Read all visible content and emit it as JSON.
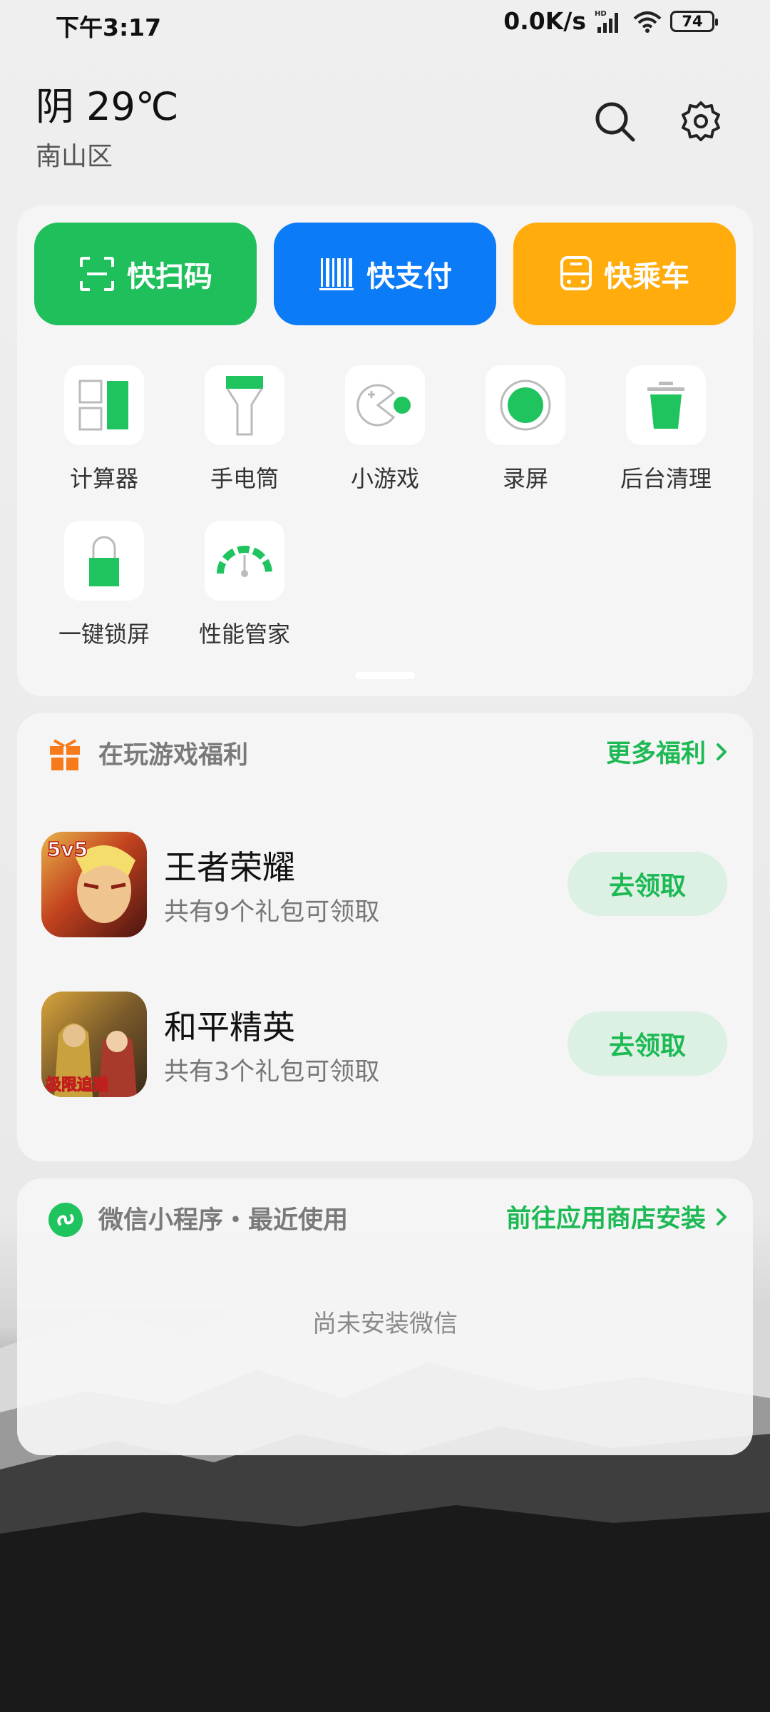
{
  "status_bar": {
    "time": "下午3:17",
    "net_speed": "0.0K/s",
    "network_badge": "HD",
    "battery": "74"
  },
  "header": {
    "weather": "阴 29℃",
    "district": "南山区",
    "search_icon": "search-icon",
    "settings_icon": "gear-icon"
  },
  "quick_actions": [
    {
      "label": "快扫码",
      "color": "#1fbf5c",
      "icon": "scan-icon"
    },
    {
      "label": "快支付",
      "color": "#0b7bf7",
      "icon": "barcode-icon"
    },
    {
      "label": "快乘车",
      "color": "#ffac0c",
      "icon": "bus-icon"
    }
  ],
  "tools": [
    {
      "label": "计算器",
      "icon": "calculator-icon"
    },
    {
      "label": "手电筒",
      "icon": "flashlight-icon"
    },
    {
      "label": "小游戏",
      "icon": "gamepad-icon"
    },
    {
      "label": "录屏",
      "icon": "record-icon"
    },
    {
      "label": "后台清理",
      "icon": "trash-icon"
    },
    {
      "label": "一键锁屏",
      "icon": "lock-icon"
    },
    {
      "label": "性能管家",
      "icon": "speedometer-icon"
    }
  ],
  "games_section": {
    "title": "在玩游戏福利",
    "more_link": "更多福利",
    "items": [
      {
        "name": "王者荣耀",
        "desc": "共有9个礼包可领取",
        "button": "去领取",
        "icon_text": "5v5"
      },
      {
        "name": "和平精英",
        "desc": "共有3个礼包可领取",
        "button": "去领取",
        "icon_text": "极限追猎"
      }
    ]
  },
  "mini_programs": {
    "title": "微信小程序・最近使用",
    "link": "前往应用商店安装",
    "empty_text": "尚未安装微信"
  },
  "colors": {
    "accent_green": "#1db954",
    "claim_bg": "#dcf1e3",
    "gift_orange": "#f77a1b"
  }
}
